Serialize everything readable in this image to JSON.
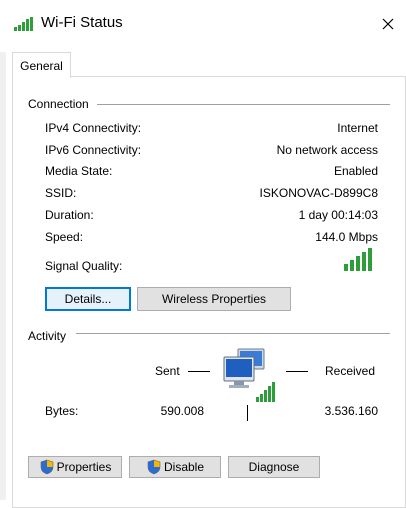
{
  "window": {
    "title": "Wi-Fi Status"
  },
  "tabs": [
    {
      "label": "General"
    }
  ],
  "connection": {
    "header": "Connection",
    "rows": [
      {
        "label": "IPv4 Connectivity:",
        "value": "Internet"
      },
      {
        "label": "IPv6 Connectivity:",
        "value": "No network access"
      },
      {
        "label": "Media State:",
        "value": "Enabled"
      },
      {
        "label": "SSID:",
        "value": "ISKONOVAC-D899C8"
      },
      {
        "label": "Duration:",
        "value": "1 day 00:14:03"
      },
      {
        "label": "Speed:",
        "value": "144.0 Mbps"
      }
    ],
    "signal_label": "Signal Quality:",
    "signal_bars": 5,
    "signal_bars_total": 5,
    "buttons": {
      "details": "Details...",
      "wireless": "Wireless Properties"
    }
  },
  "activity": {
    "header": "Activity",
    "sent_label": "Sent",
    "received_label": "Received",
    "bytes_label": "Bytes:",
    "bytes_sent": "590.008",
    "bytes_received": "3.536.160"
  },
  "footer": {
    "properties": "Properties",
    "disable": "Disable",
    "diagnose": "Diagnose"
  },
  "icons": {
    "signal": "wifi-signal-icon",
    "network": "network-computers-icon",
    "shield": "uac-shield-icon",
    "close": "close-icon"
  },
  "colors": {
    "signal_green": "#2e9e3a",
    "focus_blue": "#0078d7",
    "button_bg": "#e1e1e1"
  }
}
